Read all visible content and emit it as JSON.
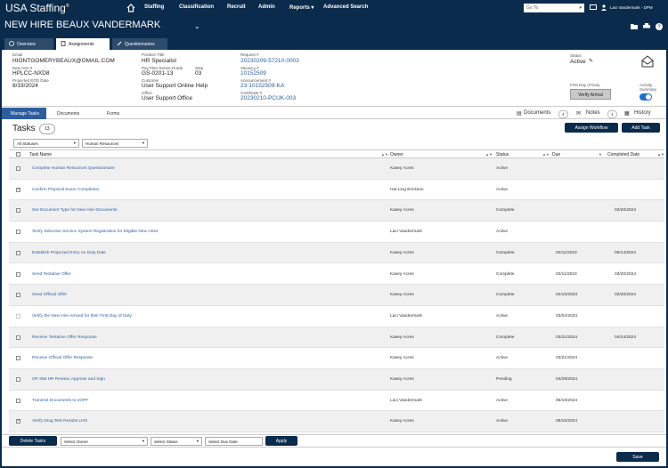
{
  "app": {
    "brand": "USA Staffing",
    "menu": [
      "Staffing",
      "Classification",
      "Recruit",
      "Admin",
      "Reports ▾",
      "Advanced Search"
    ],
    "goto_placeholder": "Go To",
    "user_name": "Laci Vandermark - DPM"
  },
  "page_title": "NEW HIRE BEAUX VANDERMARK",
  "tabs": [
    "Overview",
    "Assignments",
    "Questionnaires"
  ],
  "info": {
    "email_label": "Email",
    "email": "HIONTGOMERYBEAUX@GMAIL.COM",
    "newhire_label": "New Hire #",
    "newhire": "HPLCC-NXD8",
    "eod_label": "Projected EOD Date",
    "eod": "8/19/2024",
    "position_label": "Position Title",
    "position": "HR Specialist",
    "pay_label": "Pay Plan-Series-Grade",
    "pay": "GS-0201-13",
    "step_label": "Step",
    "step": "03",
    "customer_label": "Customer",
    "customer": "User Support Online Help",
    "office_label": "Office",
    "office": "User Support Office",
    "request_label": "Request #",
    "request": "20230209-57210-0003",
    "vacancy_label": "Vacancy #",
    "vacancy": "10152509",
    "announcement_label": "Announcement #",
    "announcement": "23-10152509-KA",
    "certificate_label": "Certificate #",
    "certificate": "20230210-PCUK-003",
    "status_label": "Status",
    "status": "Active",
    "first_day_label": "First Day of Duty",
    "verify_button": "Verify Arrival",
    "activity_label": "Activity Summary"
  },
  "subnav": {
    "crumbs": [
      "Manage Tasks",
      "Documents",
      "Forms"
    ],
    "documents_label": "Documents",
    "documents_count": "4",
    "notes_label": "Notes",
    "notes_count": "1",
    "history_label": "History"
  },
  "tasks": {
    "heading": "Tasks",
    "count": "13",
    "assign_workflow": "Assign Workflow",
    "add_task": "Add Task",
    "filter_status": "All Statuses",
    "filter_group": "Human Resources",
    "columns": [
      "Task Name",
      "Owner",
      "Status",
      "Due",
      "Completed Date"
    ],
    "rows": [
      {
        "name": "Complete Human Resources Questionnaire",
        "owner": "Kasey Acres",
        "status": "Active",
        "due": "",
        "completed": "",
        "checked": false
      },
      {
        "name": "Confirm Physical Exam Completion",
        "owner": "Hai-Ling Erickson",
        "status": "Active",
        "due": "",
        "completed": "",
        "checked": true
      },
      {
        "name": "Set Document Type for New Hire Documents",
        "owner": "Kasey Acres",
        "status": "Complete",
        "due": "",
        "completed": "03/20/2024",
        "checked": false
      },
      {
        "name": "Verify Selective Service System Registration for Eligible New Hires",
        "owner": "Laci Vandermark",
        "status": "Active",
        "due": "",
        "completed": "",
        "checked": false
      },
      {
        "name": "Establish Projected Entry on Duty Date",
        "owner": "Kasey Acres",
        "status": "Complete",
        "due": "02/11/2023",
        "completed": "08/14/2024",
        "checked": false
      },
      {
        "name": "Send Tentative Offer",
        "owner": "Kasey Acres",
        "status": "Complete",
        "due": "02/11/2023",
        "completed": "03/20/2024",
        "checked": false
      },
      {
        "name": "Send Official Offer",
        "owner": "Kasey Acres",
        "status": "Complete",
        "due": "02/15/2023",
        "completed": "03/20/2024",
        "checked": false
      },
      {
        "name": "Verify the New Hire Arrived for their First Day of Duty",
        "owner": "Laci Vandermark",
        "status": "Active",
        "due": "03/02/2023",
        "completed": "",
        "checked": false
      },
      {
        "name": "Receive Tentative Offer Response",
        "owner": "Kasey Acres",
        "status": "Complete",
        "due": "03/21/2024",
        "completed": "04/24/2024",
        "checked": false
      },
      {
        "name": "Receive Official Offer Response",
        "owner": "Kasey Acres",
        "status": "Active",
        "due": "03/21/2024",
        "completed": "",
        "checked": false
      },
      {
        "name": "OF-306 HR Review, Approve and Sign",
        "owner": "Kasey Acres",
        "status": "Pending",
        "due": "04/29/2024",
        "completed": "",
        "checked": false
      },
      {
        "name": "Transmit Documents to eOPF",
        "owner": "Laci Vandermark",
        "status": "Active",
        "due": "06/19/2024",
        "completed": "",
        "checked": false
      },
      {
        "name": "Verify Drug Test Results LHO",
        "owner": "Kasey Acres",
        "status": "Active",
        "due": "08/15/2024",
        "completed": "",
        "checked": true
      }
    ]
  },
  "footer": {
    "delete_tasks": "Delete Tasks",
    "select_owner": "Select Owner",
    "select_status": "Select Status",
    "select_due": "Select Due Date",
    "apply": "Apply",
    "save": "Save"
  }
}
